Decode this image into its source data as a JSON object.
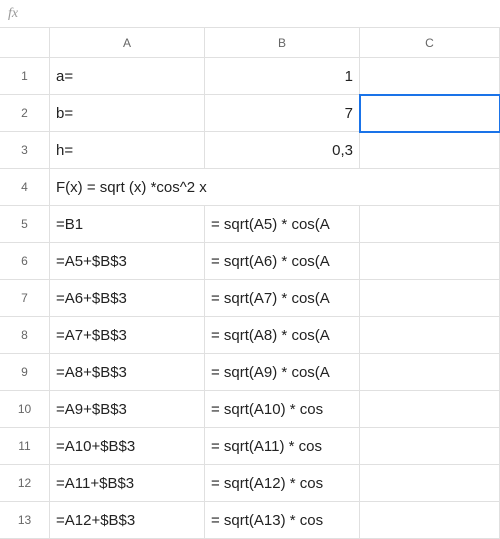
{
  "formula_bar": {
    "fx": "fx",
    "value": ""
  },
  "columns": [
    "A",
    "B",
    "C"
  ],
  "rows": [
    {
      "num": "1",
      "A": "a=",
      "B": "1",
      "C": "",
      "B_align": "right"
    },
    {
      "num": "2",
      "A": "b=",
      "B": "7",
      "C": "",
      "B_align": "right",
      "C_selected": true
    },
    {
      "num": "3",
      "A": "h=",
      "B": "0,3",
      "C": "",
      "B_align": "right"
    },
    {
      "num": "4",
      "A": "F(x) = sqrt (x) *cos^2 x",
      "merged": true
    },
    {
      "num": "5",
      "A": "=B1",
      "B": "= sqrt(A5) * cos(A",
      "C": ""
    },
    {
      "num": "6",
      "A": "=A5+$B$3",
      "B": "= sqrt(A6) * cos(A",
      "C": ""
    },
    {
      "num": "7",
      "A": "=A6+$B$3",
      "B": "= sqrt(A7) * cos(A",
      "C": ""
    },
    {
      "num": "8",
      "A": "=A7+$B$3",
      "B": "= sqrt(A8) * cos(A",
      "C": ""
    },
    {
      "num": "9",
      "A": "=A8+$B$3",
      "B": "= sqrt(A9) * cos(A",
      "C": ""
    },
    {
      "num": "10",
      "A": "=A9+$B$3",
      "B": "= sqrt(A10) * cos",
      "C": ""
    },
    {
      "num": "11",
      "A": "=A10+$B$3",
      "B": "= sqrt(A11) * cos",
      "C": ""
    },
    {
      "num": "12",
      "A": "=A11+$B$3",
      "B": "= sqrt(A12) * cos",
      "C": ""
    },
    {
      "num": "13",
      "A": "=A12+$B$3",
      "B": "= sqrt(A13) * cos",
      "C": ""
    }
  ]
}
